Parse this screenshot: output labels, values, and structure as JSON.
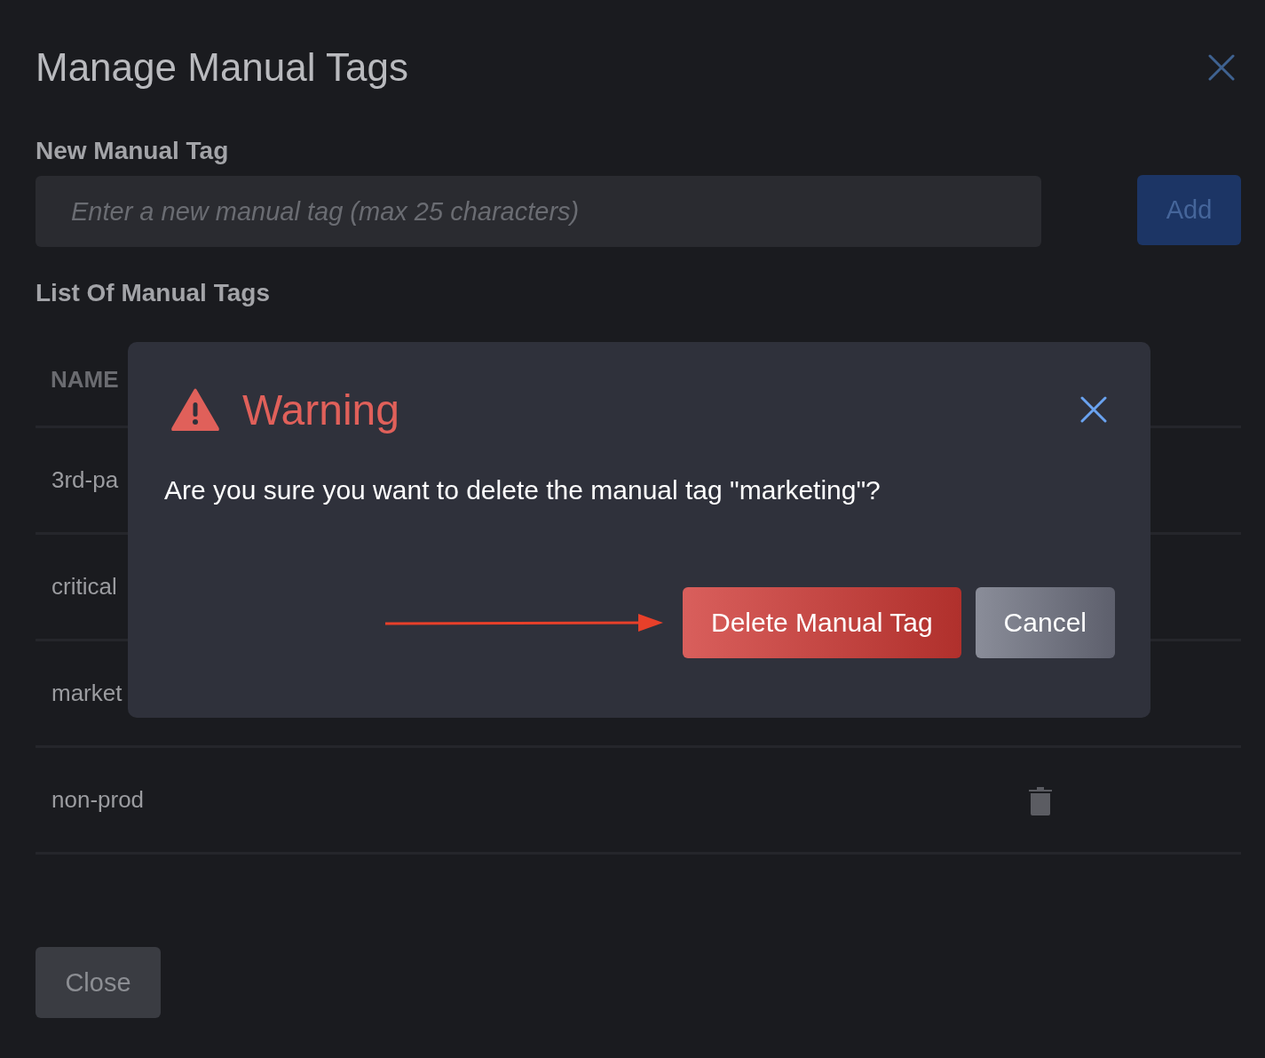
{
  "title": "Manage Manual Tags",
  "new_tag": {
    "label": "New Manual Tag",
    "placeholder": "Enter a new manual tag (max 25 characters)",
    "button": "Add",
    "button_disabled": true
  },
  "list": {
    "label": "List Of Manual Tags",
    "columns": [
      "NAME"
    ],
    "rows": [
      {
        "name": "3rd-pa"
      },
      {
        "name": "critical"
      },
      {
        "name": "market"
      },
      {
        "name": "non-prod"
      }
    ]
  },
  "close_button": "Close",
  "dialog": {
    "title": "Warning",
    "message": "Are you sure you want to delete the manual tag \"marketing\"?",
    "buttons": [
      {
        "label": "Delete Manual Tag",
        "kind": "danger"
      },
      {
        "label": "Cancel",
        "kind": "secondary"
      }
    ]
  }
}
